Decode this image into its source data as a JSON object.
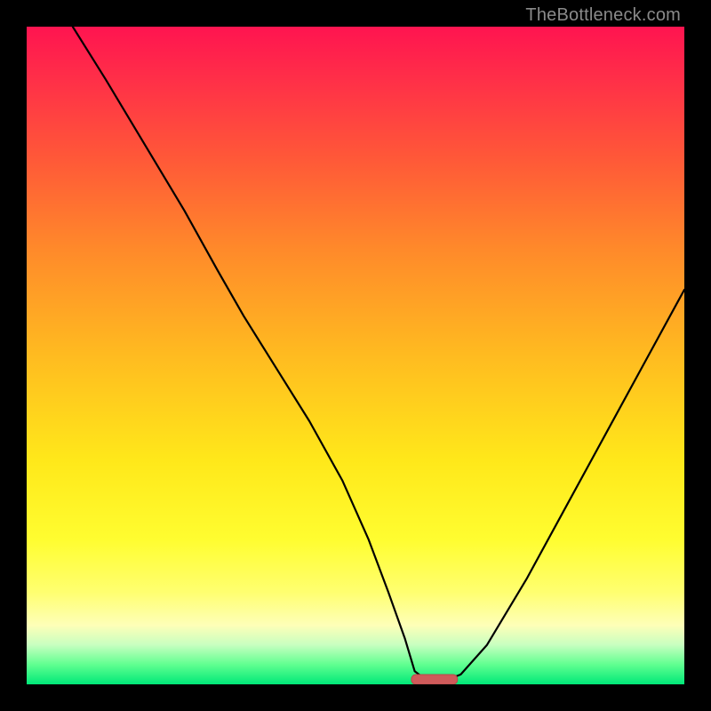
{
  "watermark": "TheBottleneck.com",
  "chart_data": {
    "type": "line",
    "title": "",
    "xlabel": "",
    "ylabel": "",
    "xlim": [
      0,
      100
    ],
    "ylim": [
      0,
      100
    ],
    "grid": false,
    "legend": false,
    "series": [
      {
        "name": "bottleneck-curve",
        "x": [
          7,
          12,
          18,
          24,
          29,
          33,
          38,
          43,
          48,
          52,
          55,
          57.5,
          59,
          61,
          63.5,
          66,
          70,
          76,
          82,
          88,
          94,
          100
        ],
        "y": [
          100,
          92,
          82,
          72,
          63,
          56,
          48,
          40,
          31,
          22,
          14,
          7,
          2,
          0.5,
          0.5,
          1.5,
          6,
          16,
          27,
          38,
          49,
          60
        ]
      }
    ],
    "marker": {
      "name": "optimal-range",
      "x_start": 58.5,
      "x_end": 65.5,
      "y": 0.4,
      "color": "#cf5a5a"
    },
    "background": {
      "gradient_stops": [
        {
          "pos": 0,
          "color": "#ff1450"
        },
        {
          "pos": 8,
          "color": "#ff2f48"
        },
        {
          "pos": 20,
          "color": "#ff5838"
        },
        {
          "pos": 34,
          "color": "#ff8a2a"
        },
        {
          "pos": 50,
          "color": "#ffbb20"
        },
        {
          "pos": 66,
          "color": "#ffe81a"
        },
        {
          "pos": 78,
          "color": "#fffd30"
        },
        {
          "pos": 86,
          "color": "#ffff70"
        },
        {
          "pos": 91,
          "color": "#feffb8"
        },
        {
          "pos": 94,
          "color": "#c8ffc0"
        },
        {
          "pos": 97,
          "color": "#60ff90"
        },
        {
          "pos": 100,
          "color": "#00e878"
        }
      ]
    }
  }
}
